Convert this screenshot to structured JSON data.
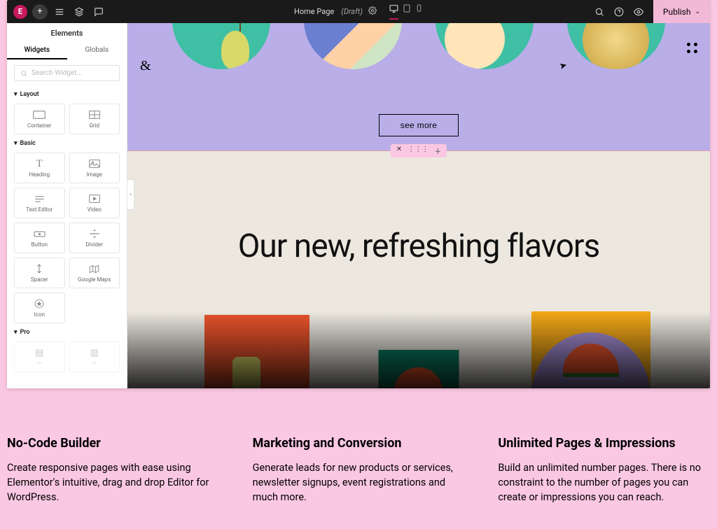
{
  "topbar": {
    "page_title": "Home Page",
    "page_status": "(Draft)",
    "publish_label": "Publish"
  },
  "sidebar": {
    "title": "Elements",
    "tabs": {
      "widgets": "Widgets",
      "globals": "Globals"
    },
    "search_placeholder": "Search Widget...",
    "sections": {
      "layout": {
        "label": "Layout",
        "items": [
          "Container",
          "Grid"
        ]
      },
      "basic": {
        "label": "Basic",
        "items": [
          "Heading",
          "Image",
          "Text Editor",
          "Video",
          "Button",
          "Divider",
          "Spacer",
          "Google Maps",
          "Icon"
        ]
      },
      "pro": {
        "label": "Pro"
      }
    }
  },
  "canvas": {
    "ampersand": "&",
    "see_more": "see more",
    "headline": "Our new, refreshing flavors"
  },
  "features": [
    {
      "title": "No-Code Builder",
      "body": "Create responsive pages with ease using Elementor's intuitive, drag and drop Editor for WordPress."
    },
    {
      "title": "Marketing and Conversion",
      "body": "Generate leads for new products or services, newsletter signups, event registrations and much more."
    },
    {
      "title": "Unlimited Pages & Impressions",
      "body": "Build an unlimited number pages. There is no constraint to the number of pages you can create or impressions you can reach."
    }
  ]
}
